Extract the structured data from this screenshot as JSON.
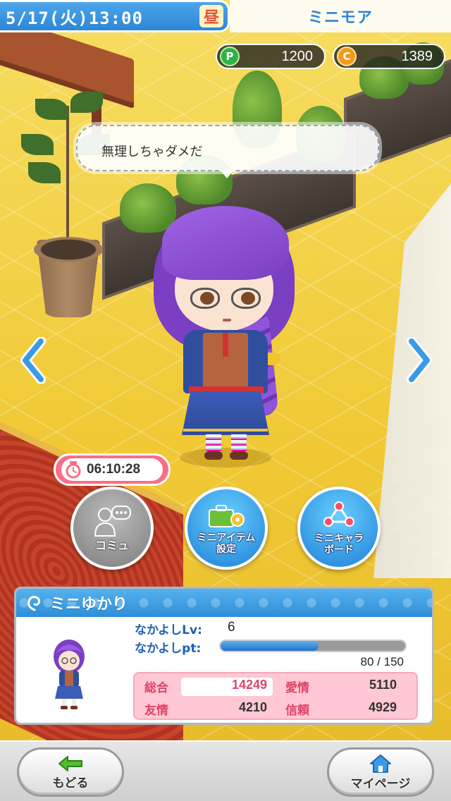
{
  "header": {
    "datetime": "5/17(火)13:00",
    "period": "昼",
    "screen_title": "ミニモア"
  },
  "currency": {
    "p_icon": "P",
    "p_amount": "1200",
    "c_icon": "C",
    "c_amount": "1389"
  },
  "speech": "無理しちゃダメだ",
  "timer": "06:10:28",
  "actions": {
    "commu": "コミュ",
    "item": "ミニアイテム\n設定",
    "board": "ミニキャラ\nボード"
  },
  "info": {
    "name": "ミニゆかり",
    "lv_label": "なかよしLv:",
    "lv_value": "6",
    "pt_label": "なかよしpt:",
    "pt_value": "80 / 150",
    "pt_progress": 0.53,
    "stats": {
      "total_label": "総合",
      "total_value": "14249",
      "love_label": "愛情",
      "love_value": "5110",
      "friend_label": "友情",
      "friend_value": "4210",
      "trust_label": "信頼",
      "trust_value": "4929"
    }
  },
  "bottom": {
    "back": "もどる",
    "mypage": "マイページ"
  },
  "colors": {
    "accent_blue": "#2b86d6",
    "timer_pink": "#ff6c86",
    "stat_pink": "#e0446a"
  }
}
